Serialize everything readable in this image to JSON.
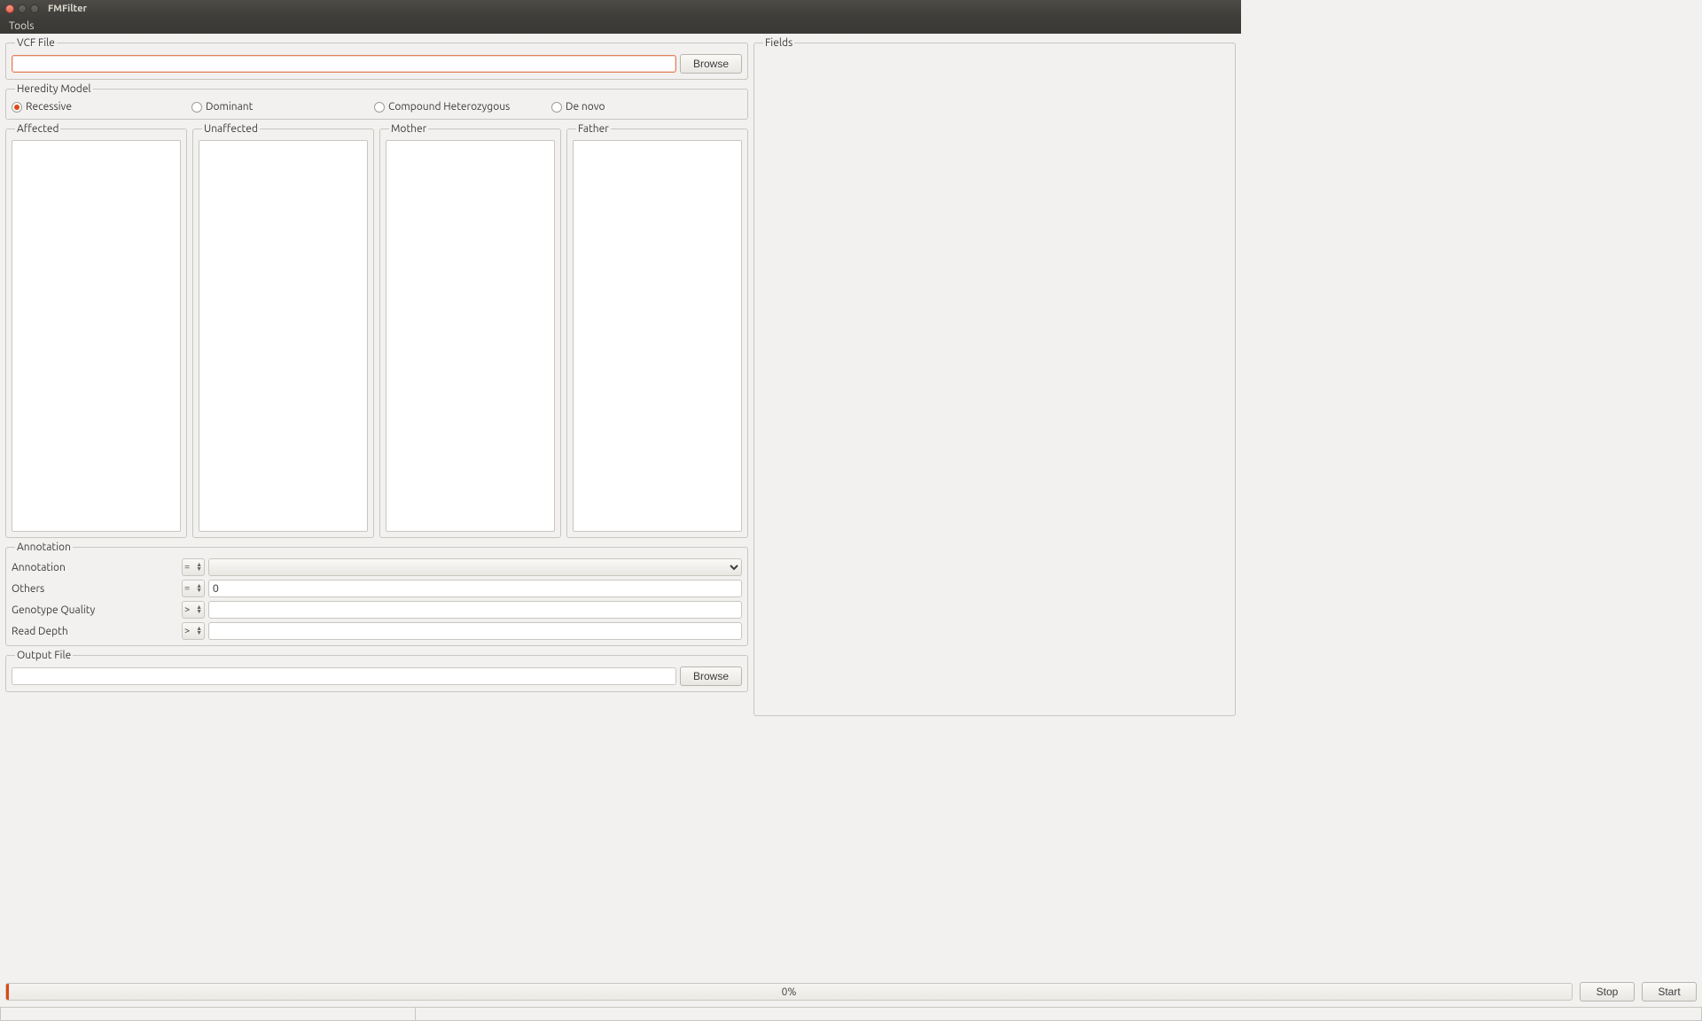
{
  "window": {
    "title": "FMFilter"
  },
  "menu": {
    "tools": "Tools"
  },
  "vcf": {
    "legend": "VCF File",
    "value": "",
    "browse": "Browse"
  },
  "heredity": {
    "legend": "Heredity Model",
    "options": {
      "recessive": "Recessive",
      "dominant": "Dominant",
      "compound": "Compound Heterozygous",
      "denovo": "De novo"
    },
    "selected": "recessive"
  },
  "samples": {
    "affected": "Affected",
    "unaffected": "Unaffected",
    "mother": "Mother",
    "father": "Father"
  },
  "annotation": {
    "legend": "Annotation",
    "rows": {
      "annotation": {
        "label": "Annotation",
        "op": "=",
        "value": ""
      },
      "others": {
        "label": "Others",
        "op": "=",
        "value": "0"
      },
      "gq": {
        "label": "Genotype Quality",
        "op": ">",
        "value": ""
      },
      "rd": {
        "label": "Read Depth",
        "op": ">",
        "value": ""
      }
    }
  },
  "output": {
    "legend": "Output File",
    "value": "",
    "browse": "Browse"
  },
  "fields": {
    "legend": "Fields"
  },
  "progress": {
    "text": "0%",
    "value": 0
  },
  "buttons": {
    "stop": "Stop",
    "start": "Start"
  }
}
